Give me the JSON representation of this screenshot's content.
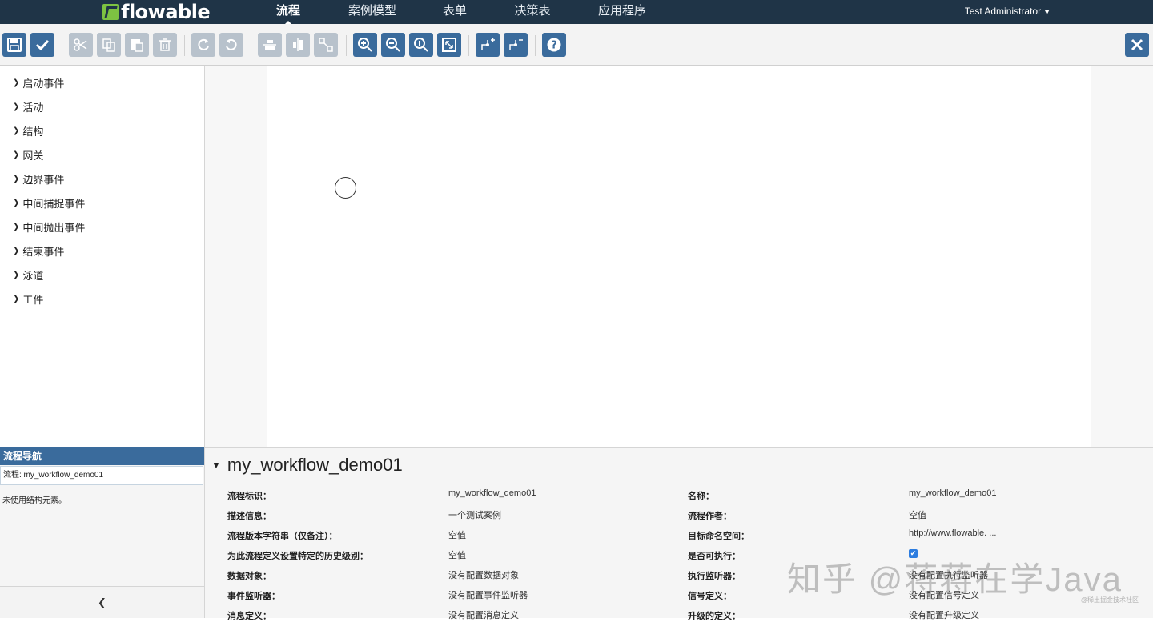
{
  "header": {
    "logo": "flowable",
    "nav": [
      "流程",
      "案例模型",
      "表单",
      "决策表",
      "应用程序"
    ],
    "active_nav": "流程",
    "user": "Test Administrator"
  },
  "toolbar": {
    "icons": [
      "save-icon",
      "validate-icon",
      "cut-icon",
      "copy-icon",
      "paste-icon",
      "delete-icon",
      "redo-icon",
      "undo-icon",
      "align-horizontal-icon",
      "align-vertical-icon",
      "same-size-icon",
      "zoom-in-icon",
      "zoom-out-icon",
      "zoom-actual-icon",
      "zoom-fit-icon",
      "bendpoint-add-icon",
      "bendpoint-remove-icon",
      "help-icon",
      "close-icon"
    ]
  },
  "palette": {
    "items": [
      "启动事件",
      "活动",
      "结构",
      "网关",
      "边界事件",
      "中间捕捉事件",
      "中间抛出事件",
      "结束事件",
      "泳道",
      "工件"
    ]
  },
  "nav_panel": {
    "title": "流程导航",
    "selected": "流程: my_workflow_demo01",
    "note": "未使用结构元素。"
  },
  "properties": {
    "title": "my_workflow_demo01",
    "left": [
      {
        "label": "流程标识：",
        "value": "my_workflow_demo01"
      },
      {
        "label": "描述信息：",
        "value": "一个测试案例"
      },
      {
        "label": "流程版本字符串（仅备注）：",
        "value": "空值"
      },
      {
        "label": "为此流程定义设置特定的历史级别：",
        "value": "空值"
      },
      {
        "label": "数据对象：",
        "value": "没有配置数据对象"
      },
      {
        "label": "事件监听器：",
        "value": "没有配置事件监听器"
      },
      {
        "label": "消息定义：",
        "value": "没有配置消息定义"
      }
    ],
    "right": [
      {
        "label": "名称：",
        "value": "my_workflow_demo01"
      },
      {
        "label": "流程作者：",
        "value": "空值"
      },
      {
        "label": "目标命名空间：",
        "value": "http://www.flowable. ..."
      },
      {
        "label": "是否可执行：",
        "value": ""
      },
      {
        "label": "执行监听器：",
        "value": "没有配置执行监听器"
      },
      {
        "label": "信号定义：",
        "value": "没有配置信号定义"
      },
      {
        "label": "升级的定义：",
        "value": "没有配置升级定义"
      }
    ],
    "is_executable": true
  },
  "watermark": {
    "main": "知乎 @蒋蒋在学Java",
    "small": "@稀土掘金技术社区"
  },
  "colors": {
    "nav_bg": "#1f3447",
    "button_blue": "#3a6b9c",
    "logo_green": "#7dc242"
  }
}
